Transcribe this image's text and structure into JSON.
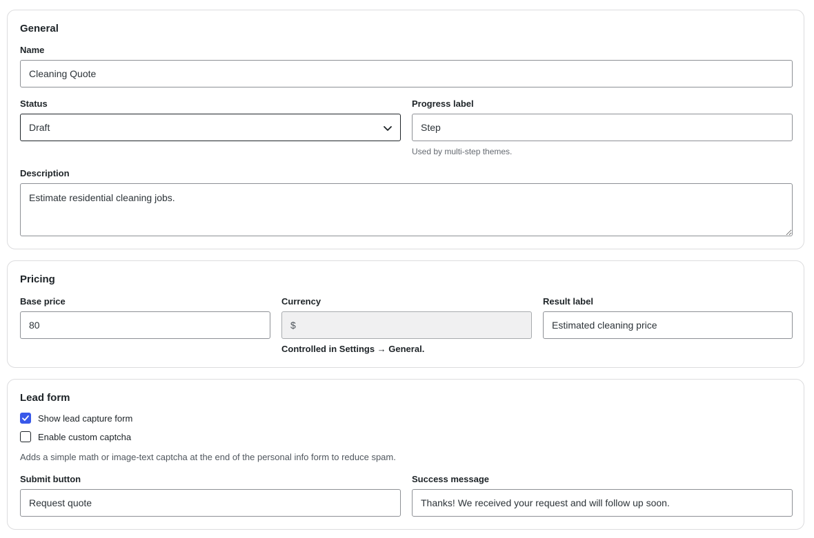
{
  "general": {
    "title": "General",
    "name_label": "Name",
    "name_value": "Cleaning Quote",
    "status_label": "Status",
    "status_value": "Draft",
    "progress_label": "Progress label",
    "progress_value": "Step",
    "progress_help": "Used by multi-step themes.",
    "description_label": "Description",
    "description_value": "Estimate residential cleaning jobs."
  },
  "pricing": {
    "title": "Pricing",
    "base_price_label": "Base price",
    "base_price_value": "80",
    "currency_label": "Currency",
    "currency_value": "$",
    "currency_help": "Controlled in Settings → General.",
    "result_label_label": "Result label",
    "result_label_value": "Estimated cleaning price"
  },
  "lead_form": {
    "title": "Lead form",
    "show_form_label": "Show lead capture form",
    "show_form_checked": true,
    "captcha_label": "Enable custom captcha",
    "captcha_checked": false,
    "captcha_help": "Adds a simple math or image-text captcha at the end of the personal info form to reduce spam.",
    "submit_label": "Submit button",
    "submit_value": "Request quote",
    "success_label": "Success message",
    "success_value": "Thanks! We received your request and will follow up soon."
  },
  "colors": {
    "accent": "#3858e9",
    "border": "#8c8f94",
    "card_border": "#dcdcde"
  }
}
